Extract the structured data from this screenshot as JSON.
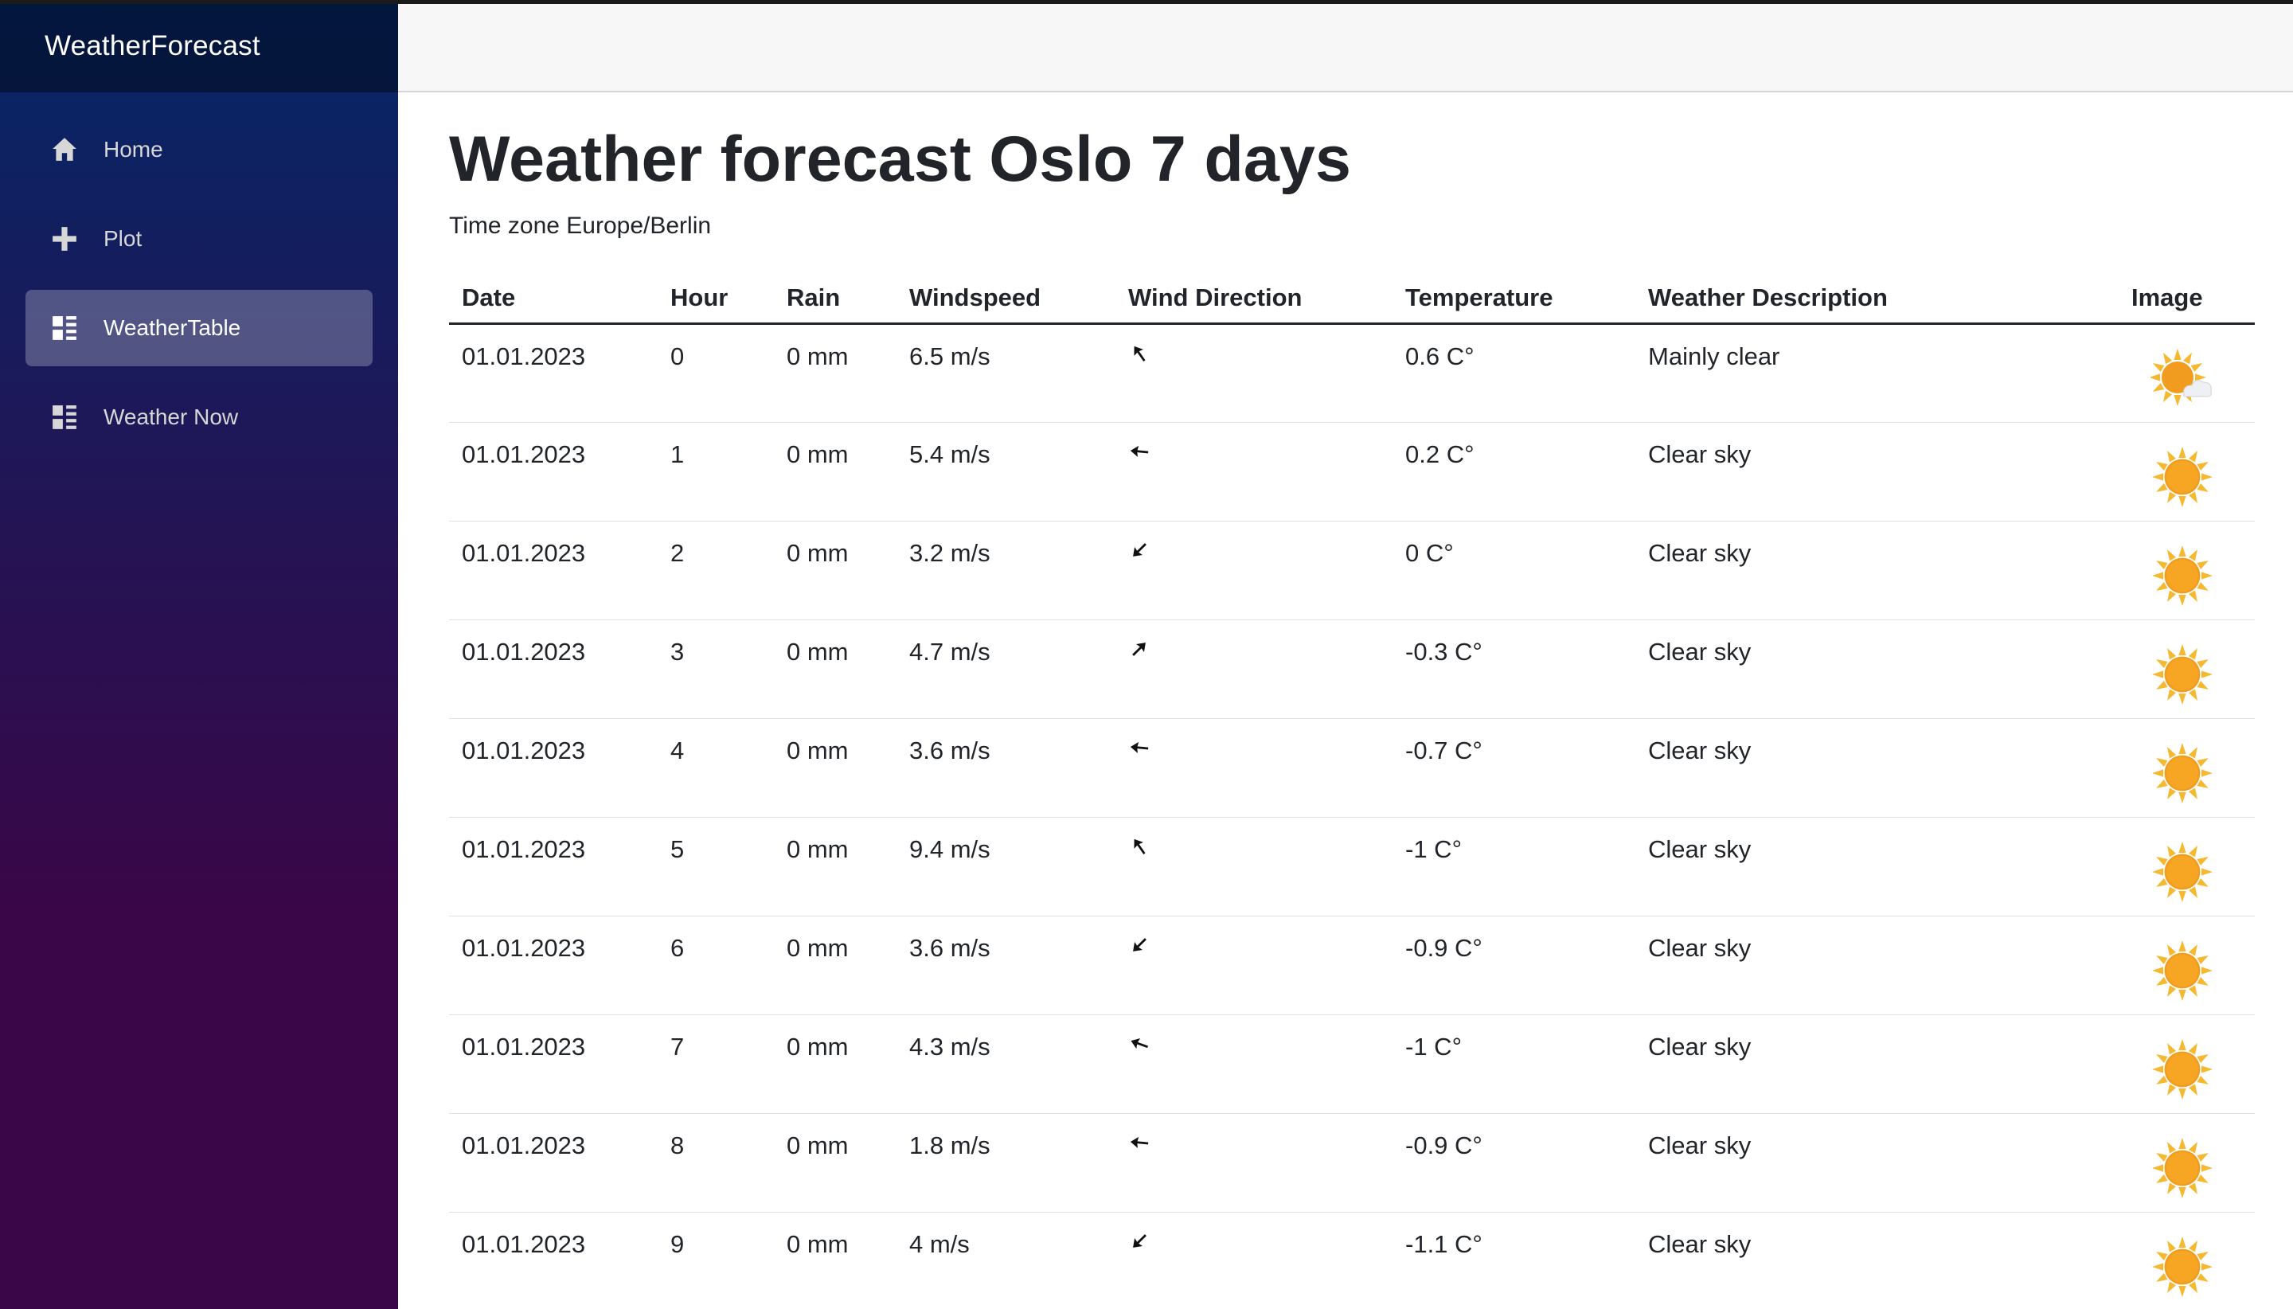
{
  "sidebar": {
    "brand": "WeatherForecast",
    "items": [
      {
        "label": "Home",
        "icon": "home-icon",
        "active": false
      },
      {
        "label": "Plot",
        "icon": "plus-icon",
        "active": false
      },
      {
        "label": "WeatherTable",
        "icon": "list-icon",
        "active": true
      },
      {
        "label": "Weather Now",
        "icon": "list-icon",
        "active": false
      }
    ]
  },
  "page": {
    "title": "Weather forecast Oslo 7 days",
    "subtitle": "Time zone Europe/Berlin"
  },
  "table": {
    "columns": [
      "Date",
      "Hour",
      "Rain",
      "Windspeed",
      "Wind Direction",
      "Temperature",
      "Weather Description",
      "Image"
    ],
    "rows": [
      {
        "date": "01.01.2023",
        "hour": "0",
        "rain": "0 mm",
        "windspeed": "6.5 m/s",
        "wind_direction": "north-west-arrow",
        "temperature": "0.6 C°",
        "description": "Mainly clear",
        "image": "sun-cloud-icon"
      },
      {
        "date": "01.01.2023",
        "hour": "1",
        "rain": "0 mm",
        "windspeed": "5.4 m/s",
        "wind_direction": "west-arrow",
        "temperature": "0.2 C°",
        "description": "Clear sky",
        "image": "sun-icon"
      },
      {
        "date": "01.01.2023",
        "hour": "2",
        "rain": "0 mm",
        "windspeed": "3.2 m/s",
        "wind_direction": "south-west-arrow",
        "temperature": "0 C°",
        "description": "Clear sky",
        "image": "sun-icon"
      },
      {
        "date": "01.01.2023",
        "hour": "3",
        "rain": "0 mm",
        "windspeed": "4.7 m/s",
        "wind_direction": "north-east-arrow",
        "temperature": "-0.3 C°",
        "description": "Clear sky",
        "image": "sun-icon"
      },
      {
        "date": "01.01.2023",
        "hour": "4",
        "rain": "0 mm",
        "windspeed": "3.6 m/s",
        "wind_direction": "west-arrow",
        "temperature": "-0.7 C°",
        "description": "Clear sky",
        "image": "sun-icon"
      },
      {
        "date": "01.01.2023",
        "hour": "5",
        "rain": "0 mm",
        "windspeed": "9.4 m/s",
        "wind_direction": "north-west-arrow",
        "temperature": "-1 C°",
        "description": "Clear sky",
        "image": "sun-icon"
      },
      {
        "date": "01.01.2023",
        "hour": "6",
        "rain": "0 mm",
        "windspeed": "3.6 m/s",
        "wind_direction": "south-west-arrow",
        "temperature": "-0.9 C°",
        "description": "Clear sky",
        "image": "sun-icon"
      },
      {
        "date": "01.01.2023",
        "hour": "7",
        "rain": "0 mm",
        "windspeed": "4.3 m/s",
        "wind_direction": "west-north-west-arrow",
        "temperature": "-1 C°",
        "description": "Clear sky",
        "image": "sun-icon"
      },
      {
        "date": "01.01.2023",
        "hour": "8",
        "rain": "0 mm",
        "windspeed": "1.8 m/s",
        "wind_direction": "west-arrow",
        "temperature": "-0.9 C°",
        "description": "Clear sky",
        "image": "sun-icon"
      },
      {
        "date": "01.01.2023",
        "hour": "9",
        "rain": "0 mm",
        "windspeed": "4 m/s",
        "wind_direction": "south-west-arrow",
        "temperature": "-1.1 C°",
        "description": "Clear sky",
        "image": "sun-icon"
      }
    ]
  },
  "colors": {
    "sidebar_top": "#052767",
    "sidebar_bottom": "#3a0647",
    "sun": "#f5b82e",
    "sun_core": "#f29c1f"
  }
}
